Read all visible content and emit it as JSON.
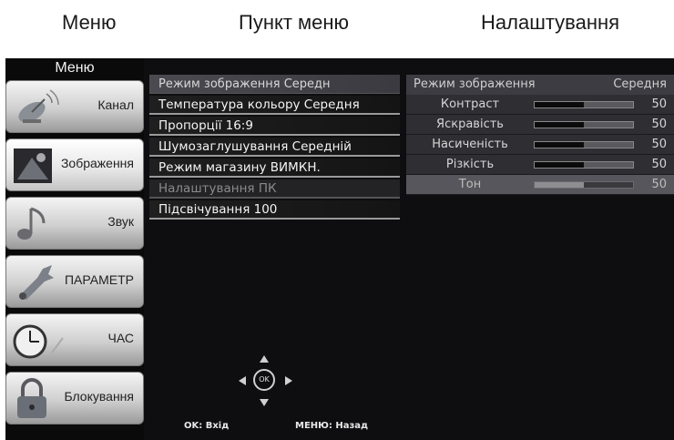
{
  "captions": {
    "menu": "Меню",
    "menu_item": "Пункт меню",
    "settings": "Налаштування"
  },
  "menu": {
    "title": "Меню",
    "items": [
      {
        "label": "Канал",
        "icon": "satellite-dish-icon"
      },
      {
        "label": "Зображення",
        "icon": "picture-icon"
      },
      {
        "label": "Звук",
        "icon": "music-note-icon"
      },
      {
        "label": "ПАРАМЕТР",
        "icon": "wrench-icon"
      },
      {
        "label": "ЧАС",
        "icon": "clock-icon"
      },
      {
        "label": "Блокування",
        "icon": "padlock-icon"
      }
    ],
    "active_index": 1
  },
  "menu_items": {
    "header": "Режим зображення Середн",
    "rows": [
      "Температура кольору Середня",
      "Пропорції 16:9",
      "Шумозаглушування Середній",
      "Режим магазину ВИМКН.",
      "Налаштування ПК",
      "Підсвічування 100"
    ],
    "disabled_index": 4
  },
  "settings": {
    "header_label": "Режим зображення",
    "header_value": "Середня",
    "rows": [
      {
        "name": "Контраст",
        "value": "50",
        "level": 0.5
      },
      {
        "name": "Яскравість",
        "value": "50",
        "level": 0.5
      },
      {
        "name": "Насиченість",
        "value": "50",
        "level": 0.5
      },
      {
        "name": "Різкість",
        "value": "50",
        "level": 0.5
      },
      {
        "name": "Тон",
        "value": "50",
        "level": 0.5
      }
    ],
    "selected_index": 4
  },
  "nav": {
    "ok_label": "OK"
  },
  "hints": {
    "ok": "OK: Вхід",
    "menu": "МЕНЮ: Назад"
  }
}
